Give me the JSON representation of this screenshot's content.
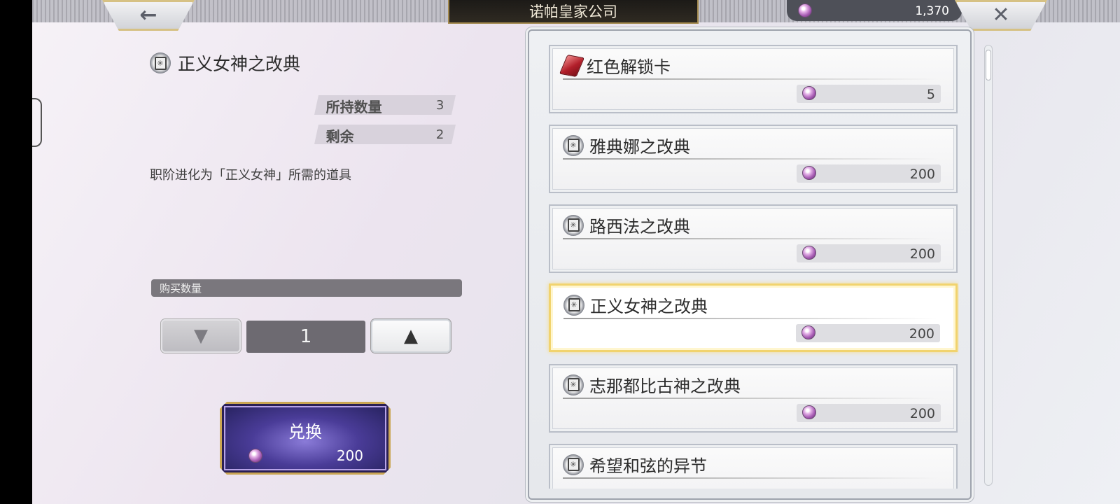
{
  "header": {
    "back_icon": "arrow-left-icon",
    "close_icon": "close-x-icon",
    "shop_title": "诺帕皇家公司",
    "currency": {
      "icon": "gem-icon",
      "amount": "1,370"
    }
  },
  "detail": {
    "item_name": "正义女神之改典",
    "item_icon": "tome-icon",
    "owned_label": "所持数量",
    "owned_value": "3",
    "remaining_label": "剩余",
    "remaining_value": "2",
    "description": "职阶进化为「正义女神」所需的道具",
    "purchase_qty_label": "购买数量",
    "qty_down_symbol": "▼",
    "qty_up_symbol": "▲",
    "quantity": "1",
    "exchange_label": "兑换",
    "exchange_cost": "200"
  },
  "items": [
    {
      "name": "红色解锁卡",
      "icon": "red-card-icon",
      "price": "5",
      "selected": false
    },
    {
      "name": "雅典娜之改典",
      "icon": "tome-icon",
      "price": "200",
      "selected": false
    },
    {
      "name": "路西法之改典",
      "icon": "tome-icon",
      "price": "200",
      "selected": false
    },
    {
      "name": "正义女神之改典",
      "icon": "tome-icon",
      "price": "200",
      "selected": true
    },
    {
      "name": "志那都比古神之改典",
      "icon": "tome-icon",
      "price": "200",
      "selected": false
    },
    {
      "name": "希望和弦的异节",
      "icon": "tome-icon",
      "price": "",
      "selected": false
    }
  ],
  "colors": {
    "highlight": "#f1d36e",
    "exchange_button": "#4a3c98",
    "gold_trim": "#caa653"
  }
}
